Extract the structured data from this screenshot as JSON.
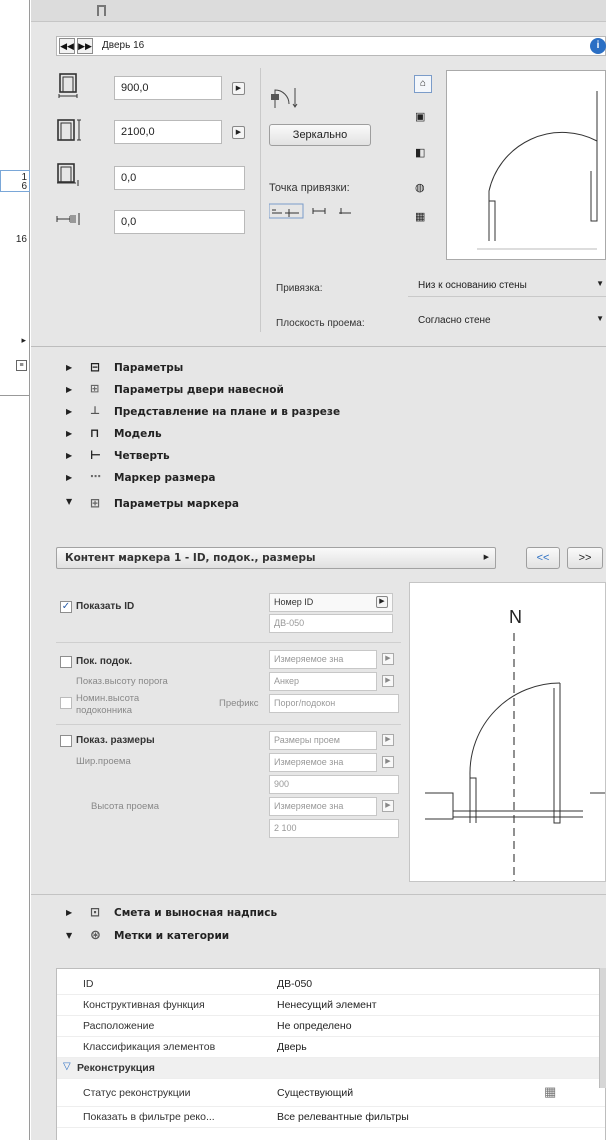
{
  "nav": {
    "prev": "◀◀",
    "next": "▶▶",
    "title": "Дверь 16"
  },
  "left_strip": {
    "v1": "1",
    "v2": "6",
    "v3": "16"
  },
  "dims": {
    "width": "900,0",
    "height": "2100,0",
    "sill": "0,0",
    "offset": "0,0"
  },
  "mirror_label": "Зеркально",
  "anchor_label": "Точка привязки:",
  "binding": {
    "label": "Привязка:",
    "value": "Низ к основанию стены"
  },
  "plane": {
    "label": "Плоскость проема:",
    "value": "Согласно стене"
  },
  "sections": {
    "params": "Параметры",
    "door_params": "Параметры двери навесной",
    "plan_view": "Представление на плане и в разрезе",
    "model": "Модель",
    "quarter": "Четверть",
    "dim_marker": "Маркер размера",
    "marker_params": "Параметры маркера",
    "estimate": "Смета и выносная надпись",
    "tags": "Метки и категории"
  },
  "marker_content": {
    "label": "Контент маркера 1 - ID, подок., размеры",
    "prev": "<<",
    "next": ">>"
  },
  "marker": {
    "show_id": "Показать ID",
    "id_type": "Номер ID",
    "id_value": "ДВ-050",
    "show_sill": "Пок. подок.",
    "sill_type": "Измеряемое зна",
    "sill_height_label": "Показ.высоту порога",
    "sill_height_value": "Анкер",
    "nominal_label_1": "Номин.высота",
    "nominal_label_2": "подоконника",
    "prefix_label": "Префикс",
    "prefix_value": "Порог/подокон",
    "show_dims": "Показ. размеры",
    "dims_type": "Размеры проем",
    "width_label": "Шир.проема",
    "width_type": "Измеряемое зна",
    "width_value": "900",
    "height_label": "Высота проема",
    "height_type": "Измеряемое зна",
    "height_value": "2 100",
    "north": "N"
  },
  "props": [
    {
      "k": "ID",
      "v": "ДВ-050"
    },
    {
      "k": "Конструктивная функция",
      "v": "Ненесущий элемент"
    },
    {
      "k": "Расположение",
      "v": "Не определено"
    },
    {
      "k": "Классификация элементов",
      "v": "Дверь"
    }
  ],
  "reconstruction": {
    "group": "Реконструкция",
    "status_k": "Статус реконструкции",
    "status_v": "Существующий",
    "filter_k": "Показать в фильтре реко...",
    "filter_v": "Все релевантные фильтры"
  }
}
